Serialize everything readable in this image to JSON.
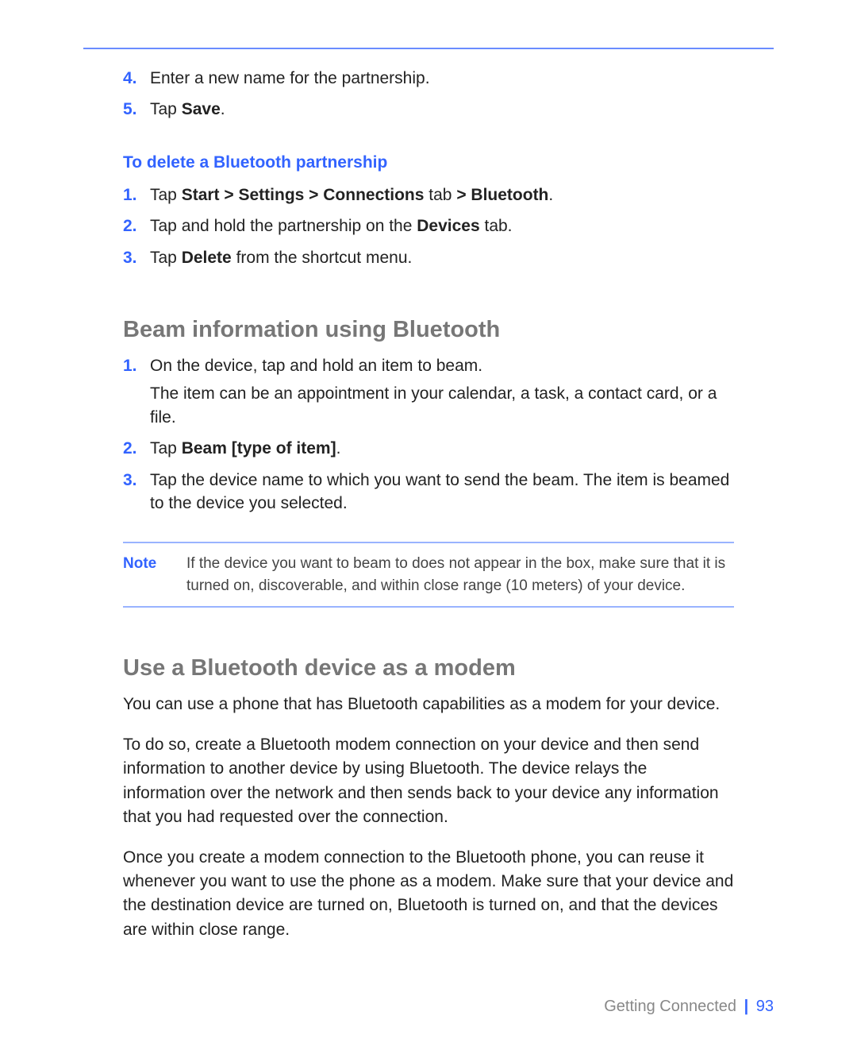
{
  "prevSection": {
    "items": [
      {
        "n": "4.",
        "text": "Enter a new name for the partnership."
      },
      {
        "n": "5.",
        "text": "Tap <b>Save</b>."
      }
    ]
  },
  "deleteSection": {
    "heading": "To delete a Bluetooth partnership",
    "items": [
      {
        "n": "1.",
        "text": "Tap <b>Start > Settings > Connections</b> tab <b>> Bluetooth</b>."
      },
      {
        "n": "2.",
        "text": "Tap and hold the partnership on the <b>Devices</b> tab."
      },
      {
        "n": "3.",
        "text": "Tap <b>Delete</b> from the shortcut menu."
      }
    ]
  },
  "beamSection": {
    "heading": "Beam information using Bluetooth",
    "items": [
      {
        "n": "1.",
        "text": "On the device, tap and hold an item to beam.<div style='height:6px'></div>The item can be an appointment in your calendar, a task, a contact card, or a file."
      },
      {
        "n": "2.",
        "text": "Tap <b>Beam [type of item]</b>."
      },
      {
        "n": "3.",
        "text": "Tap the device name to which you want to send the beam. The item is beamed to the device you selected."
      }
    ],
    "note": {
      "label": "Note",
      "text": "If the device you want to beam to does not appear in the box, make sure that it is turned on, discoverable, and within close range (10 meters) of your device."
    }
  },
  "modemSection": {
    "heading": "Use a Bluetooth device as a modem",
    "paragraphs": [
      "You can use a phone that has Bluetooth capabilities as a modem for your device.",
      "To do so, create a Bluetooth modem connection on your device and then send information to another device by using Bluetooth. The device relays the information over the network and then sends back to your device any information that you had requested over the connection.",
      "Once you create a modem connection to the Bluetooth phone, you can reuse it whenever you want to use the phone as a modem. Make sure that your device and the destination device are turned on, Bluetooth is turned on, and that the devices are within close range."
    ]
  },
  "footer": {
    "chapter": "Getting Connected",
    "page": "93"
  }
}
